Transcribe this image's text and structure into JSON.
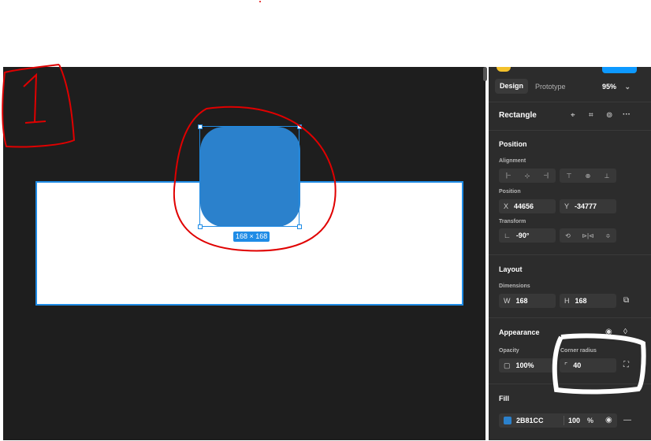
{
  "panel": {
    "tabs": {
      "design": "Design",
      "prototype": "Prototype"
    },
    "zoom": "95%",
    "layer_name": "Rectangle",
    "position": {
      "title": "Position",
      "alignment": "Alignment",
      "position_label": "Position",
      "x_key": "X",
      "x_value": "44656",
      "y_key": "Y",
      "y_value": "-34777",
      "transform": "Transform",
      "rotation": "-90°"
    },
    "layout": {
      "title": "Layout",
      "dimensions": "Dimensions",
      "w_key": "W",
      "w_value": "168",
      "h_key": "H",
      "h_value": "168"
    },
    "appearance": {
      "title": "Appearance",
      "opacity_label": "Opacity",
      "opacity_value": "100%",
      "radius_label": "Corner radius",
      "radius_value": "40"
    },
    "fill": {
      "title": "Fill",
      "hex": "2B81CC",
      "opacity": "100",
      "pct": "%"
    }
  },
  "canvas": {
    "size_badge": "168 × 168"
  },
  "annotation": {
    "number": "1"
  },
  "colors": {
    "fill": "#2B81CC",
    "selection": "#1F8CE6",
    "annotation_red": "#e00000"
  }
}
